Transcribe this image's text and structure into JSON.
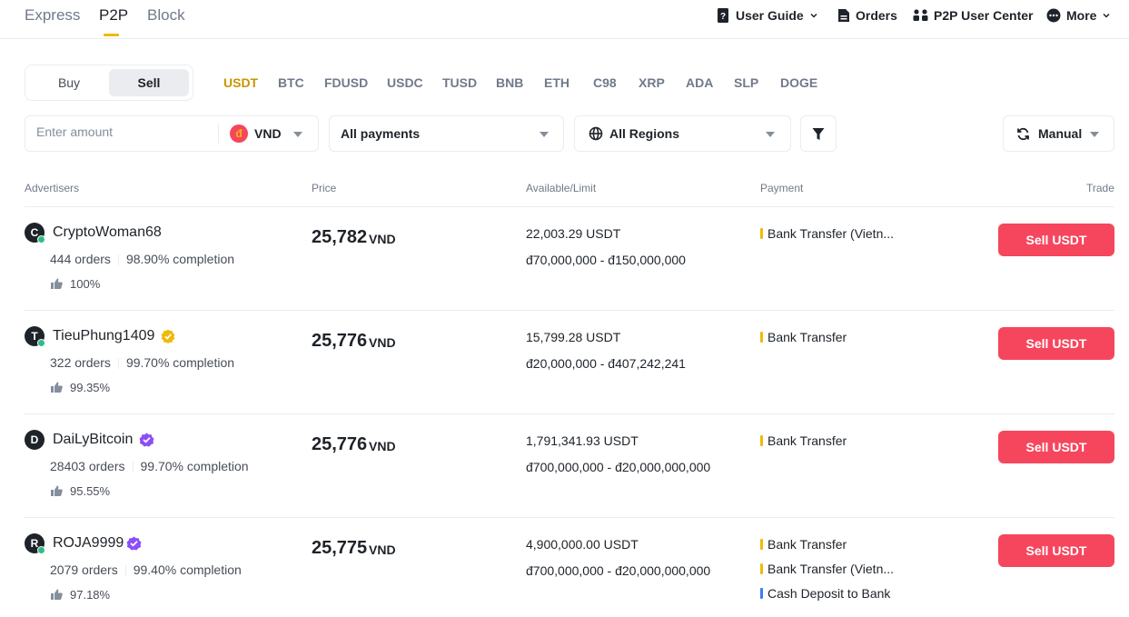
{
  "nav": {
    "tabs": [
      "Express",
      "P2P",
      "Block"
    ],
    "links": [
      "User Guide",
      "Orders",
      "P2P User Center",
      "More"
    ]
  },
  "side": {
    "buy": "Buy",
    "sell": "Sell"
  },
  "cryptos": [
    "USDT",
    "BTC",
    "FDUSD",
    "USDC",
    "TUSD",
    "BNB",
    "ETH",
    "C98",
    "XRP",
    "ADA",
    "SLP",
    "DOGE"
  ],
  "filters": {
    "amount_placeholder": "Enter amount",
    "fiat_symbol": "đ",
    "fiat": "VND",
    "payments": "All payments",
    "regions": "All Regions",
    "refresh": "Manual"
  },
  "table": {
    "headers": {
      "advertisers": "Advertisers",
      "price": "Price",
      "available": "Available/Limit",
      "payment": "Payment",
      "trade": "Trade"
    },
    "rows": [
      {
        "initial": "C",
        "name": "CryptoWoman68",
        "badge": "none",
        "online": true,
        "orders": "444 orders",
        "completion": "98.90% completion",
        "like": "100%",
        "price": "25,782",
        "unit": "VND",
        "available": "22,003.29 USDT",
        "limit": "đ70,000,000 - đ150,000,000",
        "payments": [
          "Bank Transfer (Vietn..."
        ],
        "action": "Sell USDT"
      },
      {
        "initial": "T",
        "name": "TieuPhung1409",
        "badge": "gold",
        "online": true,
        "orders": "322 orders",
        "completion": "99.70% completion",
        "like": "99.35%",
        "price": "25,776",
        "unit": "VND",
        "available": "15,799.28 USDT",
        "limit": "đ20,000,000 - đ407,242,241",
        "payments": [
          "Bank Transfer"
        ],
        "action": "Sell USDT"
      },
      {
        "initial": "D",
        "name": "DaiLyBitcoin",
        "badge": "purple",
        "online": false,
        "orders": "28403 orders",
        "completion": "99.70% completion",
        "like": "95.55%",
        "price": "25,776",
        "unit": "VND",
        "available": "1,791,341.93 USDT",
        "limit": "đ700,000,000 - đ20,000,000,000",
        "payments": [
          "Bank Transfer"
        ],
        "action": "Sell USDT"
      },
      {
        "initial": "R",
        "name": "ROJA9999",
        "badge": "purple",
        "online": true,
        "orders": "2079 orders",
        "completion": "99.40% completion",
        "like": "97.18%",
        "price": "25,775",
        "unit": "VND",
        "available": "4,900,000.00 USDT",
        "limit": "đ700,000,000 - đ20,000,000,000",
        "payments": [
          "Bank Transfer",
          "Bank Transfer (Vietn...",
          "Cash Deposit to Bank"
        ],
        "action": "Sell USDT"
      }
    ]
  },
  "colors": {
    "accent": "#f0b90b",
    "active_crypto": "#c99400",
    "sell": "#f6465d",
    "online": "#2ebd85",
    "verified_gold": "#f0b90b",
    "verified_purple": "#8d4df8"
  }
}
